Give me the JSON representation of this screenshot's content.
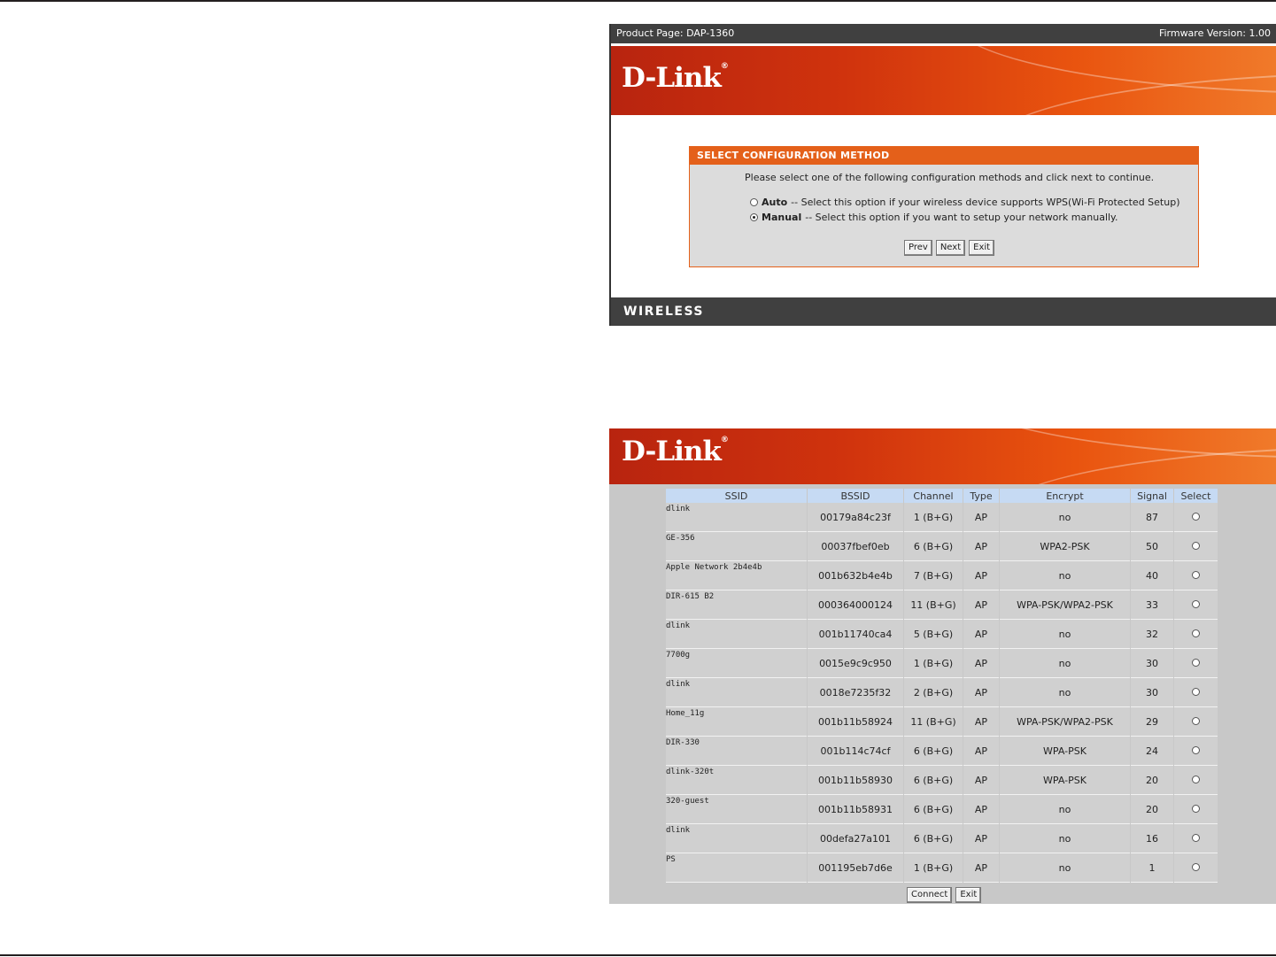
{
  "shot1": {
    "product_page": "Product Page: DAP-1360",
    "firmware": "Firmware Version: 1.00",
    "logo": "D-Link",
    "panel": {
      "title": "SELECT CONFIGURATION METHOD",
      "intro": "Please select one of the following configuration methods and click next to continue.",
      "options": [
        {
          "label": "Auto",
          "desc": "-- Select this option if your wireless device supports WPS(Wi-Fi Protected Setup)",
          "selected": false
        },
        {
          "label": "Manual",
          "desc": "-- Select this option if you want to setup your network manually.",
          "selected": true
        }
      ],
      "buttons": {
        "prev": "Prev",
        "next": "Next",
        "exit": "Exit"
      }
    },
    "footer": "WIRELESS"
  },
  "shot2": {
    "logo": "D-Link",
    "columns": [
      "SSID",
      "BSSID",
      "Channel",
      "Type",
      "Encrypt",
      "Signal",
      "Select"
    ],
    "rows": [
      [
        "dlink",
        "00179a84c23f",
        "1 (B+G)",
        "AP",
        "no",
        "87"
      ],
      [
        "GE-356",
        "00037fbef0eb",
        "6 (B+G)",
        "AP",
        "WPA2-PSK",
        "50"
      ],
      [
        "Apple Network 2b4e4b",
        "001b632b4e4b",
        "7 (B+G)",
        "AP",
        "no",
        "40"
      ],
      [
        "DIR-615 B2",
        "000364000124",
        "11 (B+G)",
        "AP",
        "WPA-PSK/WPA2-PSK",
        "33"
      ],
      [
        "dlink",
        "001b11740ca4",
        "5 (B+G)",
        "AP",
        "no",
        "32"
      ],
      [
        "7700g",
        "0015e9c9c950",
        "1 (B+G)",
        "AP",
        "no",
        "30"
      ],
      [
        "dlink",
        "0018e7235f32",
        "2 (B+G)",
        "AP",
        "no",
        "30"
      ],
      [
        "Home_11g",
        "001b11b58924",
        "11 (B+G)",
        "AP",
        "WPA-PSK/WPA2-PSK",
        "29"
      ],
      [
        "DIR-330",
        "001b114c74cf",
        "6 (B+G)",
        "AP",
        "WPA-PSK",
        "24"
      ],
      [
        "dlink-320t",
        "001b11b58930",
        "6 (B+G)",
        "AP",
        "WPA-PSK",
        "20"
      ],
      [
        "320-guest",
        "001b11b58931",
        "6 (B+G)",
        "AP",
        "no",
        "20"
      ],
      [
        "dlink",
        "00defa27a101",
        "6 (B+G)",
        "AP",
        "no",
        "16"
      ],
      [
        "PS",
        "001195eb7d6e",
        "1 (B+G)",
        "AP",
        "no",
        "1"
      ]
    ],
    "buttons": {
      "connect": "Connect",
      "exit": "Exit"
    }
  }
}
